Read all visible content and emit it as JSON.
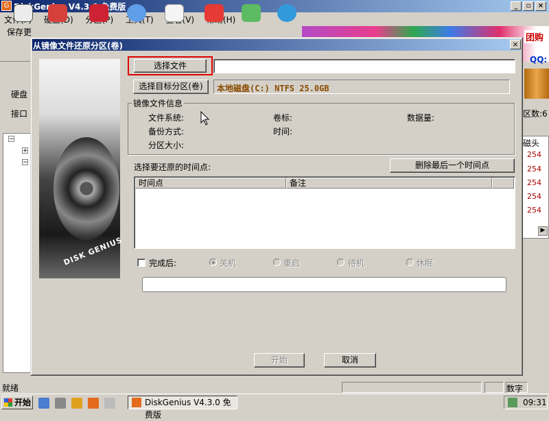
{
  "app": {
    "title": "DiskGenius V4.3.0 免费版",
    "menu": [
      "文件(F)",
      "硬盘(D)",
      "分区(P)",
      "工具(T)",
      "查看(V)",
      "帮助(H)"
    ],
    "toolbar_save_label": "保存更",
    "left_labels": [
      "硬盘",
      "接口"
    ],
    "ad_text": "团购",
    "ad_qq": "QQ:",
    "right_zone_label": "区数:6",
    "right_header": "磁头",
    "right_values": [
      "254",
      "254",
      "254",
      "254",
      "254"
    ],
    "status_text": "就绪",
    "status_num": "数字"
  },
  "dialog": {
    "title": "从镜像文件还原分区(卷)",
    "close_glyph": "×",
    "select_file_button": "选择文件",
    "select_file_value": "",
    "select_target_button": "选择目标分区(卷)",
    "target_value": "本地磁盘(C:) NTFS 25.0GB",
    "image_info_group": "镜像文件信息",
    "image_info": {
      "filesystem_label": "文件系统:",
      "volume_label": "卷标:",
      "data_size_label": "数据量:",
      "backup_method_label": "备份方式:",
      "time_label": "时间:",
      "partition_size_label": "分区大小:"
    },
    "restore_point_label": "选择要还原的时间点:",
    "delete_last_button": "删除最后一个时间点",
    "columns": [
      "时间点",
      "备注"
    ],
    "rows": [],
    "after_done": {
      "checkbox_label": "完成后:",
      "checked": false,
      "options": [
        "关机",
        "重启",
        "待机",
        "休眠"
      ],
      "selected": "关机"
    },
    "progress": 0,
    "start_button": "开始",
    "cancel_button": "取消",
    "side_brand": "DISK GENIUS"
  },
  "taskbar": {
    "start_label": "开始",
    "task_label": "DiskGenius V4.3.0 免费版",
    "clock": "09:31"
  }
}
